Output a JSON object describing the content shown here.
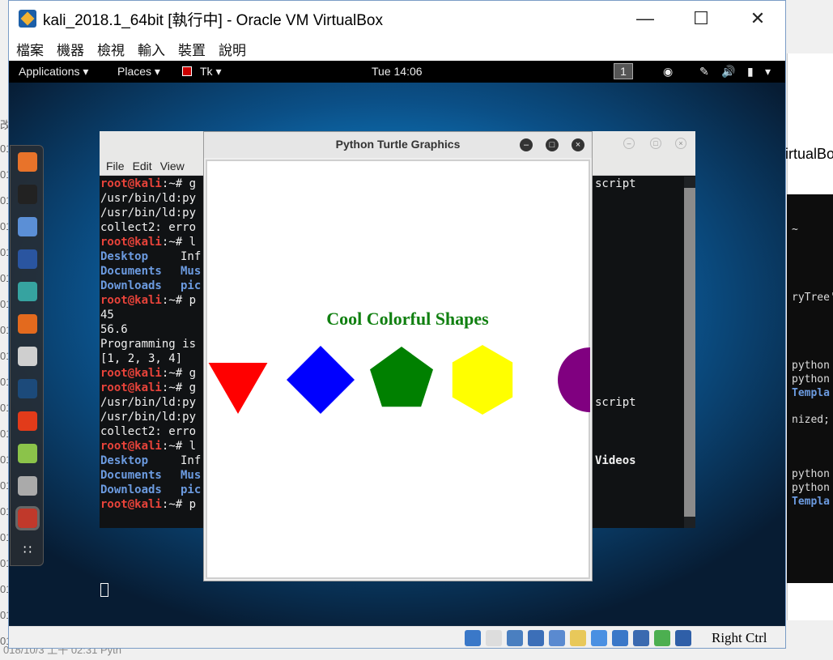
{
  "host": {
    "right_window_title_fragment": "irtualBo",
    "right_terminal_lines": [
      "~",
      "ryTree'",
      "python",
      "python",
      "Templa",
      "nized;",
      "python",
      "python",
      "Templa"
    ],
    "left_fragment_chars": [
      "改",
      "01",
      "01",
      "01",
      "01",
      "01",
      "01",
      "01",
      "01",
      "01",
      "01",
      "01",
      "01",
      "01",
      "01",
      "01",
      "01",
      "01",
      "01",
      "01",
      "01"
    ],
    "bottom_fragment": "018/10/3 上午 02:31    Pyth"
  },
  "vbox": {
    "title": "kali_2018.1_64bit [執行中] - Oracle VM VirtualBox",
    "window_controls": {
      "minimize": "—",
      "maximize": "☐",
      "close": "✕"
    },
    "menu": [
      "檔案",
      "機器",
      "檢視",
      "輸入",
      "裝置",
      "說明"
    ],
    "host_key": "Right Ctrl",
    "status_icons": [
      "hard-disk-icon",
      "optical-drive-icon",
      "audio-icon",
      "network-icon",
      "usb-icon",
      "shared-folders-icon",
      "display-icon",
      "recording-icon",
      "cpu-icon",
      "mouse-integration-icon",
      "keyboard-capture-icon"
    ]
  },
  "kali": {
    "topbar": {
      "applications": "Applications ▾",
      "places": "Places ▾",
      "app": "Tk ▾",
      "clock": "Tue 14:06",
      "workspace": "1",
      "tray_icons": [
        "camera-icon",
        "brightness-icon",
        "volume-icon",
        "battery-icon",
        "system-menu-icon"
      ]
    },
    "dock_icons": [
      "firefox-icon",
      "terminal-icon",
      "files-icon",
      "metasploit-icon",
      "armitage-icon",
      "burpsuite-icon",
      "maltego-icon",
      "beef-icon",
      "faraday-icon",
      "leafpad-icon",
      "keyboard-icon",
      "tk-icon",
      "show-apps-icon"
    ]
  },
  "terminal": {
    "menu": [
      "File",
      "Edit",
      "View"
    ],
    "lines": [
      {
        "prompt": "root@kali",
        "rest": ":~# g",
        "tail": "script"
      },
      {
        "text": "/usr/bin/ld:py"
      },
      {
        "text": "/usr/bin/ld:py"
      },
      {
        "text": "collect2: erro"
      },
      {
        "prompt": "root@kali",
        "rest": ":~# l"
      },
      {
        "cols": [
          "Desktop",
          "Inf"
        ]
      },
      {
        "cols": [
          "Documents",
          "Mus"
        ]
      },
      {
        "cols": [
          "Downloads",
          "pic"
        ]
      },
      {
        "prompt": "root@kali",
        "rest": ":~# p"
      },
      {
        "text": "45"
      },
      {
        "text": "56.6"
      },
      {
        "text": "Programming is"
      },
      {
        "text": "[1, 2, 3, 4]"
      },
      {
        "prompt": "root@kali",
        "rest": ":~# g"
      },
      {
        "prompt": "root@kali",
        "rest": ":~# g"
      },
      {
        "text": "/usr/bin/ld:py",
        "tail": "script"
      },
      {
        "text": "/usr/bin/ld:py"
      },
      {
        "text": "collect2: erro"
      },
      {
        "prompt": "root@kali",
        "rest": ":~# l"
      },
      {
        "cols": [
          "Desktop",
          "Inf"
        ],
        "tail": "Videos"
      },
      {
        "cols": [
          "Documents",
          "Mus"
        ]
      },
      {
        "cols": [
          "Downloads",
          "pic"
        ]
      },
      {
        "prompt": "root@kali",
        "rest": ":~# p"
      }
    ]
  },
  "turtle": {
    "title": "Python Turtle Graphics",
    "heading": "Cool Colorful Shapes",
    "shapes": [
      {
        "name": "triangle",
        "color": "#ff0000"
      },
      {
        "name": "square",
        "color": "#0000ff"
      },
      {
        "name": "pentagon",
        "color": "#008000"
      },
      {
        "name": "hexagon",
        "color": "#ffff00"
      },
      {
        "name": "circle",
        "color": "#800080"
      }
    ]
  }
}
